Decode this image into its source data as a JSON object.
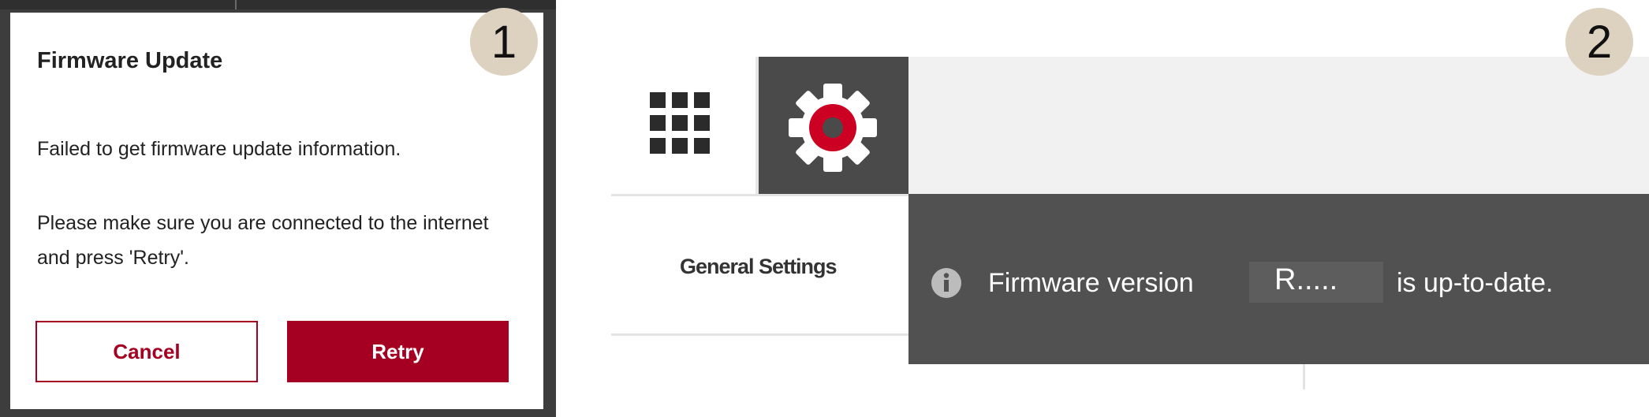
{
  "panel1": {
    "step_badge": "1",
    "dialog": {
      "title": "Firmware Update",
      "message_line1": "Failed to get firmware update information.",
      "message_line2": "Please make sure you are connected to the internet and press 'Retry'.",
      "cancel_label": "Cancel",
      "retry_label": "Retry"
    }
  },
  "panel2": {
    "step_badge": "2",
    "toolbar": {
      "apps_icon": "grid-9-icon",
      "settings_icon": "gear-icon"
    },
    "sidebar": {
      "active_item": "General Settings"
    },
    "notification": {
      "icon": "info-icon",
      "prefix": "Firmware version",
      "version": "R.....",
      "suffix": "is up-to-date."
    }
  },
  "colors": {
    "accent": "#a50021",
    "dark_panel": "#525152",
    "toolbar_dark": "#4a4a4a",
    "badge": "#ddd2c0"
  }
}
